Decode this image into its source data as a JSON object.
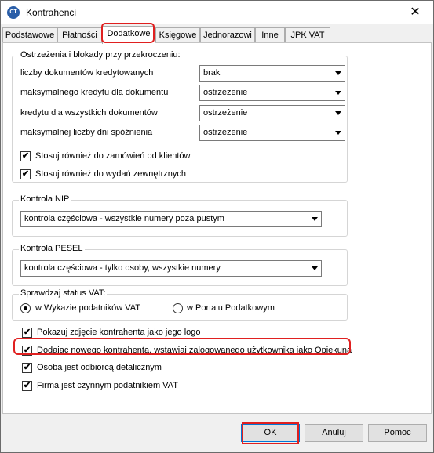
{
  "window": {
    "title": "Kontrahenci",
    "icon": "app-logo-icon",
    "close_glyph": "✕"
  },
  "tabs": [
    {
      "label": "Podstawowe"
    },
    {
      "label": "Płatności"
    },
    {
      "label": "Dodatkowe"
    },
    {
      "label": "Księgowe"
    },
    {
      "label": "Jednorazowi"
    },
    {
      "label": "Inne"
    },
    {
      "label": "JPK VAT"
    }
  ],
  "active_tab": "Dodatkowe",
  "warnings": {
    "legend": "Ostrzeżenia i blokady przy przekroczeniu:",
    "rows": [
      {
        "label": "liczby dokumentów kredytowanych",
        "value": "brak"
      },
      {
        "label": "maksymalnego kredytu dla  dokumentu",
        "value": "ostrzeżenie"
      },
      {
        "label": "kredytu dla wszystkich dokumentów",
        "value": "ostrzeżenie"
      },
      {
        "label": "maksymalnej liczby dni spóźnienia",
        "value": "ostrzeżenie"
      }
    ],
    "checks": [
      {
        "label": "Stosuj również do zamówień od klientów",
        "checked": true
      },
      {
        "label": "Stosuj również do wydań zewnętrznych",
        "checked": true
      }
    ]
  },
  "nip": {
    "legend": "Kontrola NIP",
    "value": "kontrola częściowa - wszystkie numery poza pustym"
  },
  "pesel": {
    "legend": "Kontrola PESEL",
    "value": "kontrola częściowa - tylko osoby, wszystkie numery"
  },
  "vat": {
    "legend": "Sprawdzaj status VAT:",
    "options": [
      {
        "label": "w Wykazie podatników VAT",
        "selected": true
      },
      {
        "label": "w Portalu Podatkowym",
        "selected": false
      }
    ]
  },
  "options": [
    {
      "label": "Pokazuj zdjęcie kontrahenta jako jego logo",
      "checked": true
    },
    {
      "label": "Dodając nowego kontrahenta, wstawiaj zalogowanego użytkownika jako Opiekuna",
      "checked": true
    },
    {
      "label": "Osoba jest odbiorcą detalicznym",
      "checked": true
    },
    {
      "label": "Firma jest czynnym podatnikiem VAT",
      "checked": true
    }
  ],
  "check_glyph": "✔",
  "buttons": {
    "ok": "OK",
    "cancel": "Anuluj",
    "help": "Pomoc"
  },
  "colors": {
    "highlight": "#e02020",
    "accent": "#0078d7"
  }
}
